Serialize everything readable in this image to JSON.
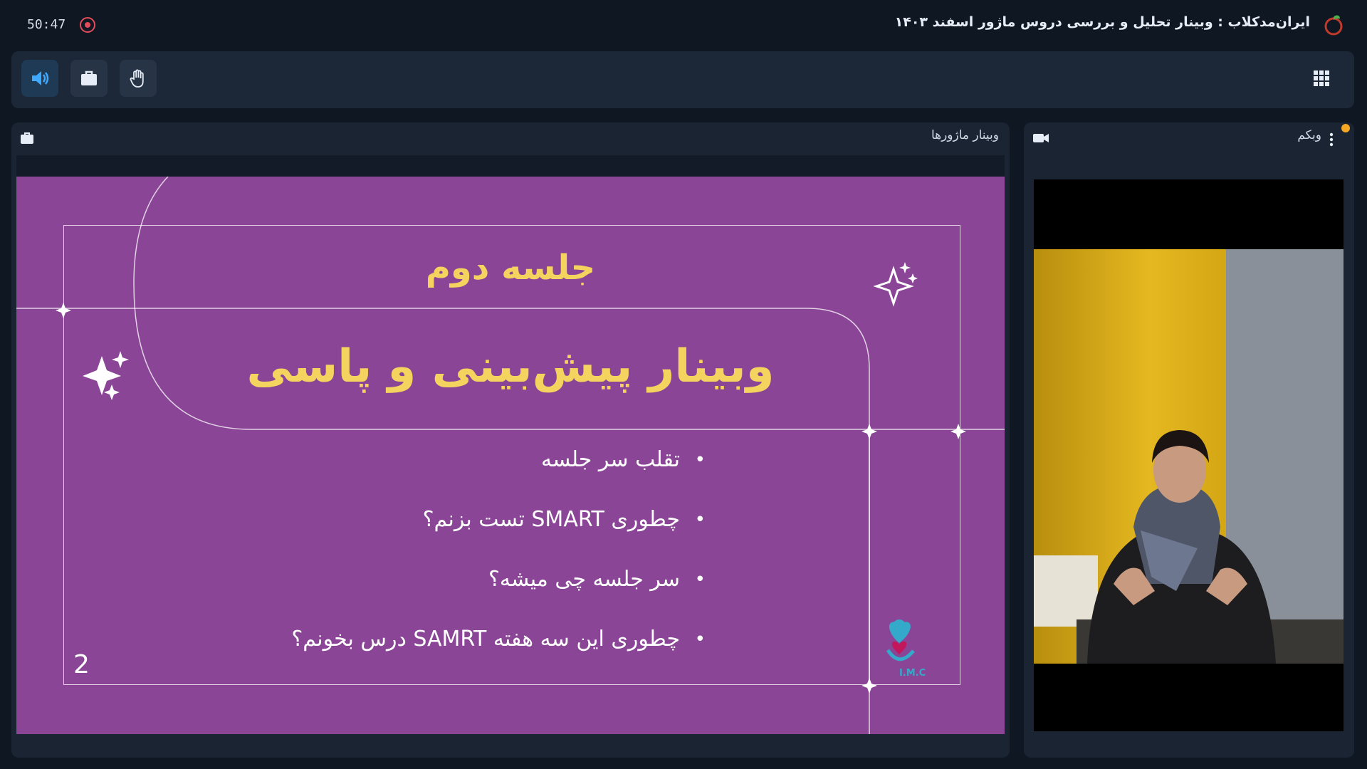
{
  "header": {
    "timer": "50:47",
    "title": "ایران‌مدکلاب : وبینار تحلیل و بررسی دروس ماژور اسفند ۱۴۰۳"
  },
  "toolbar": {
    "buttons": [
      "speaker-icon",
      "briefcase-icon",
      "hand-icon"
    ],
    "apps_icon": "grid-icon"
  },
  "presentation": {
    "panel_title": "وبینار ماژورها",
    "slide": {
      "session_label": "جلسه دوم",
      "title": "وبینار پیش‌بینی و پاسی",
      "bullets": [
        "تقلب سر جلسه",
        "چطوری SMART تست بزنم؟",
        "سر جلسه چی میشه؟",
        "چطوری این سه هفته SAMRT درس بخونم؟"
      ],
      "page_number": "2",
      "logo_text": "I.M.C"
    }
  },
  "webcam": {
    "panel_title": "وبکم"
  },
  "colors": {
    "slide_bg": "#8a4596",
    "slide_accent": "#f4d35e",
    "speaker_active": "#3fa9ff",
    "record": "#e14b5a",
    "notification": "#f5a623"
  }
}
